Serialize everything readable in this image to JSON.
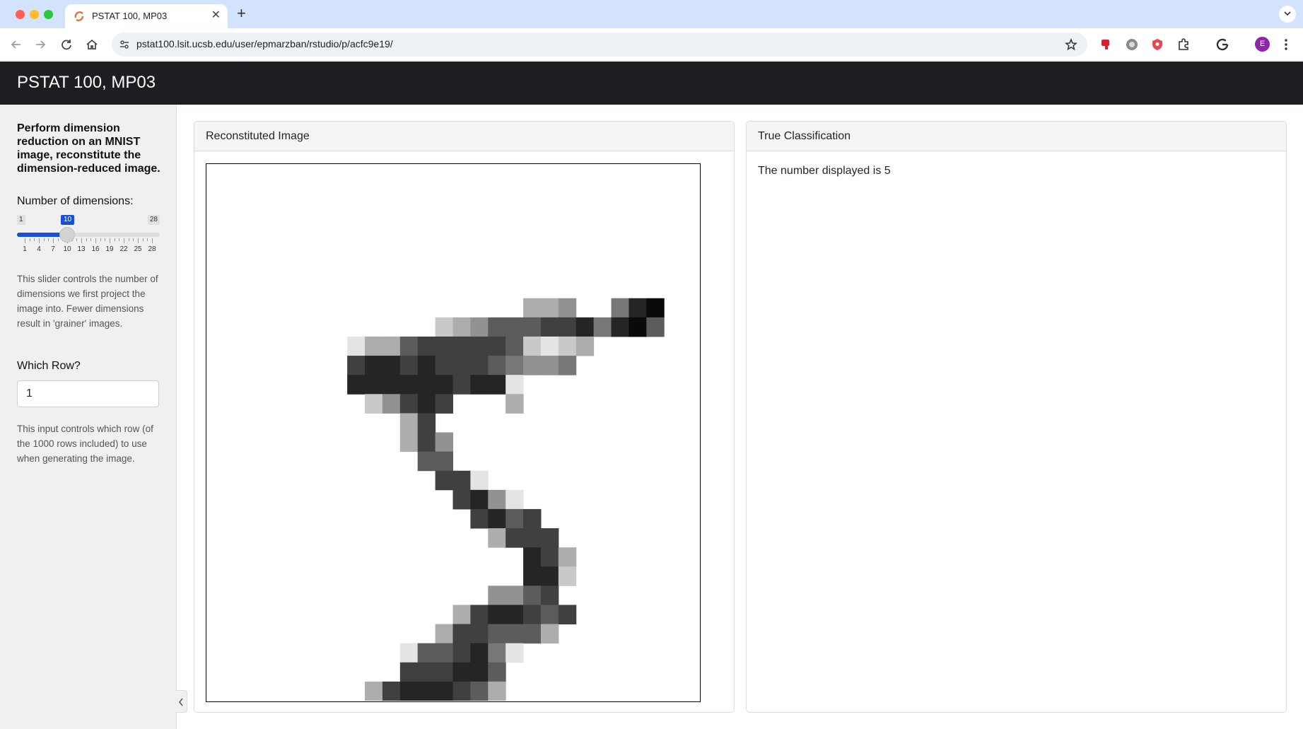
{
  "browser": {
    "tab_title": "PSTAT 100, MP03",
    "url": "pstat100.lsit.ucsb.edu/user/epmarzban/rstudio/p/acfc9e19/",
    "profile_initial": "E",
    "icons": [
      "back-icon",
      "forward-icon",
      "reload-icon",
      "home-icon",
      "site-info-icon",
      "star-icon",
      "extension-icons",
      "google-icon",
      "kebab-menu-icon"
    ]
  },
  "app": {
    "title": "PSTAT 100, MP03"
  },
  "sidebar": {
    "intro": "Perform dimension reduction on an MNIST image, reconstitute the dimension-reduced image.",
    "dimensions_label": "Number of dimensions:",
    "slider": {
      "min": 1,
      "max": 28,
      "value": 10,
      "tick_labels": [
        "1",
        "4",
        "7",
        "10",
        "13",
        "16",
        "19",
        "22",
        "25",
        "28"
      ],
      "accent_color": "#1450dc"
    },
    "dimensions_help": "This slider controls the number of dimensions we first project the image into. Fewer dimensions result in 'grainer' images.",
    "row_label": "Which Row?",
    "row_value": "1",
    "row_help": "This input controls which row (of the 1000 rows included) to use when generating the image."
  },
  "panels": {
    "image": {
      "header": "Reconstituted Image",
      "image_grid": {
        "col_start": 6,
        "row_start": 7,
        "cols": 20,
        "rows": 22,
        "scale": "intensity 0 (white) to 9 (black)",
        "pixels": [
          "00000000000033400589",
          "00000002346667785896",
          "00133677777621230000",
          "00788787776544500000",
          "00888888788100000000",
          "00024787000300000000",
          "00000370000000000000",
          "00000374000000000000",
          "00000066000000000000",
          "00000007710000000000",
          "00000000784100000000",
          "00000000078670000000",
          "00000000003777000000",
          "00000000000087300000",
          "00000000000088200000",
          "00000000004467000000",
          "00000000378876700000",
          "00000003776663000000",
          "00000166785100000000",
          "00000777886000000000",
          "00037888763000000000",
          "00678777420000000000"
        ]
      }
    },
    "classification": {
      "header": "True Classification",
      "text": "The number displayed is 5"
    }
  }
}
